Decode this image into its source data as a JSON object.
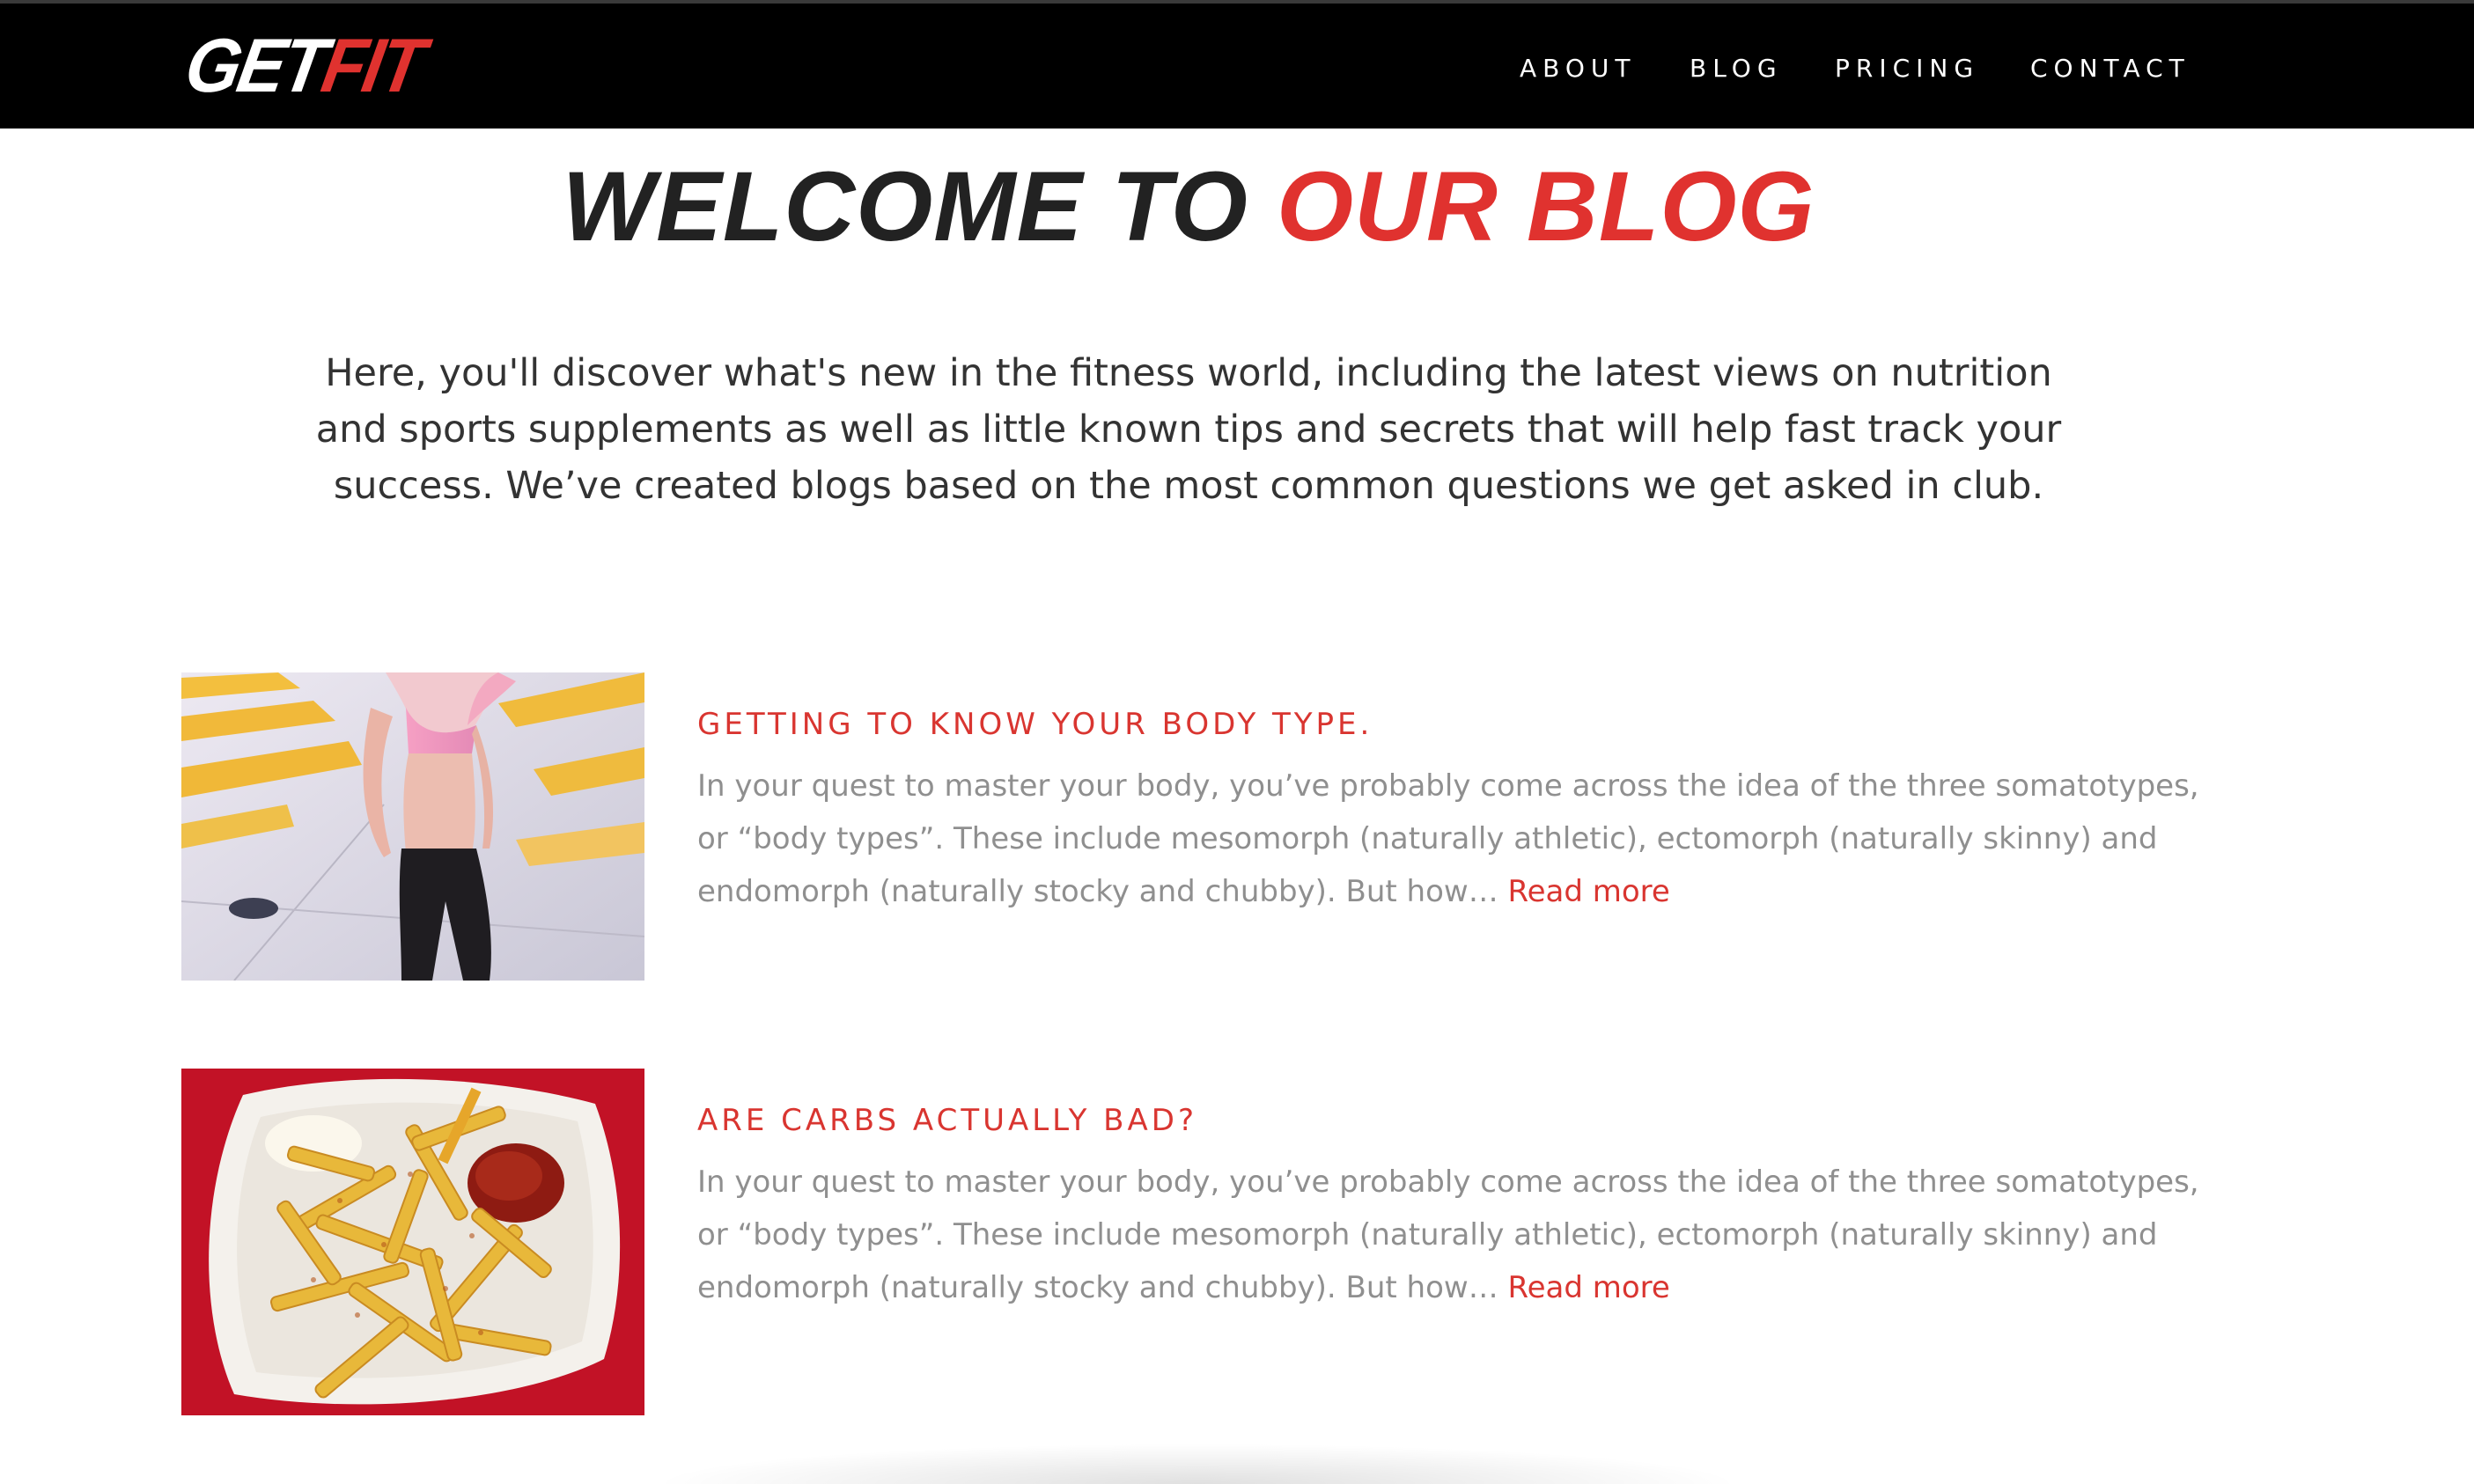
{
  "brand": {
    "logo_part1": "GET",
    "logo_part2": "FIT",
    "accent": "#e0322f"
  },
  "nav": {
    "items": [
      {
        "label": "ABOUT"
      },
      {
        "label": "BLOG"
      },
      {
        "label": "PRICING"
      },
      {
        "label": "CONTACT"
      }
    ]
  },
  "hero": {
    "title_part1": "WELCOME TO",
    "title_part2": "OUR BLOG",
    "intro": "Here, you'll discover what's new in the fitness world, including the latest views on nutrition and sports supplements as well as little known tips and secrets that will help fast track your success. We’ve created blogs based on the most common questions we get asked in club."
  },
  "posts": [
    {
      "image_icon": "runner-photo",
      "title": "GETTING TO KNOW YOUR BODY TYPE.",
      "excerpt": "In your quest to master your body, you’ve probably come across the idea of the three somatotypes, or “body types”. These include mesomorph (naturally athletic), ectomorph (naturally skinny) and endomorph (naturally stocky and chubby). But how…",
      "read_more": "Read more"
    },
    {
      "image_icon": "fries-photo",
      "title": "ARE CARBS ACTUALLY BAD?",
      "excerpt": "In your quest to master your body, you’ve probably come across the idea of the three somatotypes, or “body types”. These include mesomorph (naturally athletic), ectomorph (naturally skinny) and endomorph (naturally stocky and chubby). But how…",
      "read_more": "Read more"
    }
  ]
}
